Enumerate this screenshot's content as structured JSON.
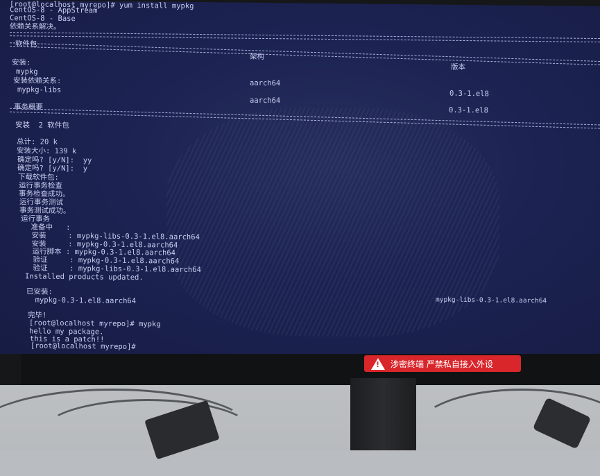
{
  "terminal": {
    "lines": {
      "l1": "[root@localhost myrepo]# yum install mypkg",
      "l2": "CentOS-8 - AppStream",
      "l3": "CentOS-8 - Base",
      "l4": "依赖关系解决。",
      "hdr_pkg": "软件包",
      "hdr_arch": "架构",
      "hdr_ver": "版本",
      "install": "安装:",
      "pkg1": "mypkg",
      "pkg1_arch": "aarch64",
      "pkg1_ver": "0.3-1.el8",
      "dep": "安装依赖关系:",
      "pkg2": "mypkg-libs",
      "pkg2_arch": "aarch64",
      "pkg2_ver": "0.3-1.el8",
      "summary": "事务概要",
      "install_count": "安装  2 软件包",
      "total": "总计: 20 k",
      "size": "安装大小: 139 k",
      "confirm1": "确定吗? [y/N]:  yy",
      "confirm2": "确定吗? [y/N]:  y",
      "download": "下载软件包:",
      "check": "运行事务检查",
      "check_ok": "事务检查成功。",
      "test": "运行事务测试",
      "test_ok": "事务测试成功。",
      "run": "运行事务",
      "prep": "  准备中   :",
      "inst1": "  安装     : mypkg-libs-0.3-1.el8.aarch64",
      "inst2": "  安装     : mypkg-0.3-1.el8.aarch64",
      "script": "  运行脚本 : mypkg-0.3-1.el8.aarch64",
      "verify1": "  验证     : mypkg-0.3-1.el8.aarch64",
      "verify2": "  验证     : mypkg-libs-0.3-1.el8.aarch64",
      "products": "Installed products updated.",
      "installed": "已安装:",
      "inst_a": "  mypkg-0.3-1.el8.aarch64",
      "inst_b": "mypkg-libs-0.3-1.el8.aarch64",
      "done": "完毕!",
      "cmd2": "[root@localhost myrepo]# mypkg",
      "out1": "hello my package.",
      "out2": "this is a patch!!",
      "prompt": "[root@localhost myrepo]#"
    }
  },
  "sticker": {
    "text": "涉密终端  严禁私自接入外设",
    "color": "#d8262b"
  },
  "colors": {
    "screen_bg": "#1c2352",
    "text": "#c9cdf0"
  }
}
